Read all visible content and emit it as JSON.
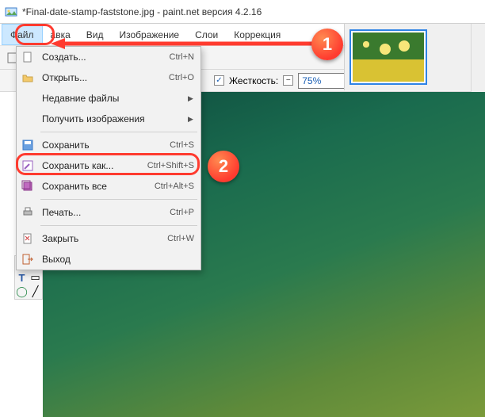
{
  "title": "*Final-date-stamp-faststone.jpg - paint.net версия 4.2.16",
  "menubar": {
    "file": "Файл",
    "edit": "авка",
    "view": "Вид",
    "image": "Изображение",
    "layers": "Слои",
    "adjust": "Коррекция"
  },
  "subtoolbar": {
    "antialias_checked": "✓",
    "stiffness_label": "Жесткость:",
    "stiffness_value": "75%",
    "slider_minus": "−"
  },
  "dropdown": {
    "create": {
      "label": "Создать...",
      "shortcut": "Ctrl+N"
    },
    "open": {
      "label": "Открыть...",
      "shortcut": "Ctrl+O"
    },
    "recent": {
      "label": "Недавние файлы"
    },
    "acquire": {
      "label": "Получить изображения"
    },
    "save": {
      "label": "Сохранить",
      "shortcut": "Ctrl+S"
    },
    "saveas": {
      "label": "Сохранить как...",
      "shortcut": "Ctrl+Shift+S"
    },
    "saveall": {
      "label": "Сохранить все",
      "shortcut": "Ctrl+Alt+S"
    },
    "print": {
      "label": "Печать...",
      "shortcut": "Ctrl+P"
    },
    "close": {
      "label": "Закрыть",
      "shortcut": "Ctrl+W"
    },
    "exit": {
      "label": "Выход"
    }
  },
  "badges": {
    "one": "1",
    "two": "2"
  }
}
